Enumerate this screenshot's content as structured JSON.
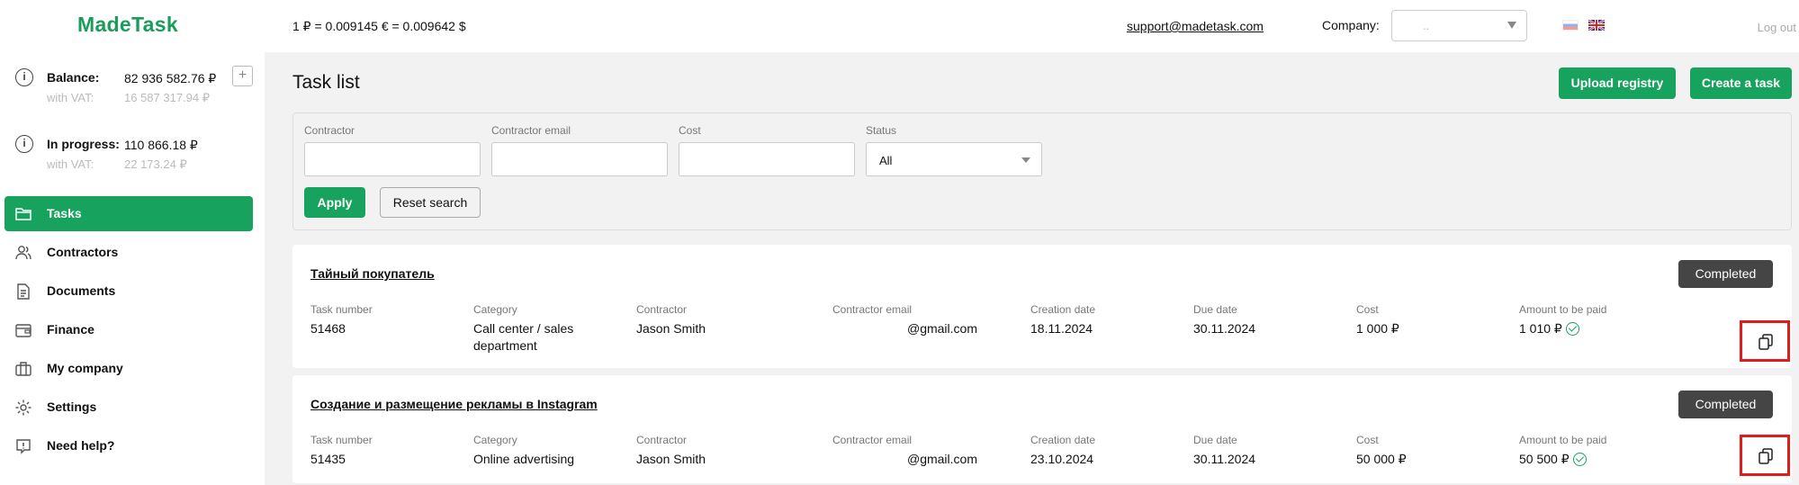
{
  "header": {
    "logo": "MadeTask",
    "rates": "1 ₽ = 0.009145 € = 0.009642 $",
    "support_email": "support@madetask.com",
    "company_label": "Company:",
    "company_value": "..",
    "logout": "Log out"
  },
  "sidebar": {
    "balance_label": "Balance:",
    "balance_value": "82 936 582.76 ₽",
    "balance_vat_label": "with VAT:",
    "balance_vat_value": "16 587 317.94 ₽",
    "progress_label": "In progress:",
    "progress_value": "110 866.18 ₽",
    "progress_vat_label": "with VAT:",
    "progress_vat_value": "22 173.24 ₽",
    "plus": "+",
    "items": [
      {
        "label": "Tasks",
        "icon": "folder-icon",
        "active": true
      },
      {
        "label": "Contractors",
        "icon": "people-icon"
      },
      {
        "label": "Documents",
        "icon": "document-icon"
      },
      {
        "label": "Finance",
        "icon": "wallet-icon"
      },
      {
        "label": "My company",
        "icon": "briefcase-icon"
      },
      {
        "label": "Settings",
        "icon": "gear-icon"
      },
      {
        "label": "Need help?",
        "icon": "help-icon"
      }
    ]
  },
  "main": {
    "title": "Task list",
    "upload_button": "Upload registry",
    "create_button": "Create a task",
    "filters": {
      "contractor_label": "Contractor",
      "email_label": "Contractor email",
      "cost_label": "Cost",
      "status_label": "Status",
      "status_value": "All",
      "apply": "Apply",
      "reset": "Reset search"
    },
    "columns": [
      "Task number",
      "Category",
      "Contractor",
      "Contractor email",
      "Creation date",
      "Due date",
      "Cost",
      "Amount to be paid"
    ],
    "tasks": [
      {
        "name": "Тайный покупатель",
        "status": "Completed",
        "number": "51468",
        "category": "Call center / sales department",
        "contractor": "Jason Smith",
        "email": "@gmail.com",
        "created": "18.11.2024",
        "due": "30.11.2024",
        "cost": "1 000 ₽",
        "amount": "1 010 ₽"
      },
      {
        "name": "Создание и размещение рекламы в Instagram",
        "status": "Completed",
        "number": "51435",
        "category": "Online advertising",
        "contractor": "Jason Smith",
        "email": "@gmail.com",
        "created": "23.10.2024",
        "due": "30.11.2024",
        "cost": "50 000 ₽",
        "amount": "50 500 ₽"
      }
    ]
  },
  "colors": {
    "accent": "#17a35e",
    "badge": "#454545",
    "highlight": "#e01b1b"
  }
}
